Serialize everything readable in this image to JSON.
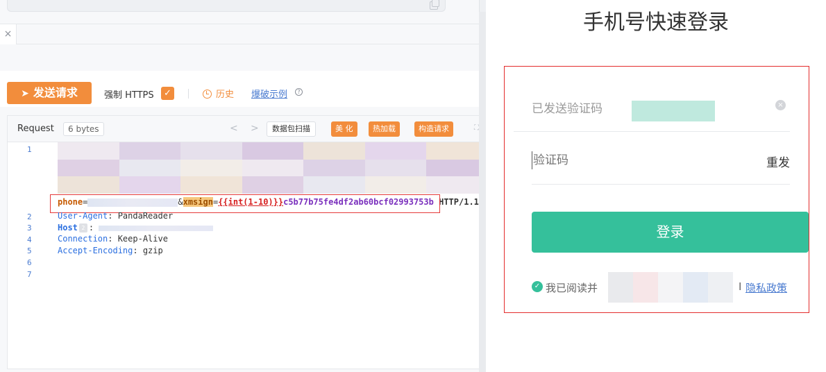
{
  "tab": {
    "close_glyph": "×"
  },
  "toolbar": {
    "send_label": "发送请求",
    "https_label": "强制 HTTPS",
    "history_label": "历史",
    "brute_example_label": "爆破示例",
    "https_checked": true
  },
  "editor": {
    "request_label": "Request",
    "bytes_label": "6 bytes",
    "buttons": {
      "packet_scan": "数据包扫描",
      "beautify": "美 化",
      "hot_load": "热加载",
      "build_request": "构造请求"
    },
    "line_numbers": [
      "1",
      "2",
      "3",
      "4",
      "5",
      "6",
      "7"
    ],
    "line1": {
      "phone_key": "phone",
      "eq1": "=",
      "amp": "&",
      "xmsign_key": "xmsign",
      "eq2": "=",
      "template": "{{int(1-10)}}",
      "hash": "c5b77b75fe4df2ab60bcf02993753b",
      "protocol": "HTTP/1.1"
    },
    "headers": [
      {
        "name": "User-Agent",
        "sep": ": ",
        "value": "PandaReader"
      },
      {
        "name": "Host",
        "badge": "2",
        "sep": ": ",
        "value": ""
      },
      {
        "name": "Connection",
        "sep": ": ",
        "value": "Keep-Alive"
      },
      {
        "name": "Accept-Encoding",
        "sep": ": ",
        "value": "gzip"
      }
    ]
  },
  "login": {
    "title": "手机号快速登录",
    "sent_code_text": "已发送验证码",
    "code_placeholder": "验证码",
    "resend_label": "重发",
    "login_button": "登录",
    "agree_text": "我已阅读并",
    "privacy_prefix": "I",
    "privacy_link": "隐私政策"
  },
  "colors": {
    "accent_orange": "#f28d3c",
    "accent_green": "#35c09b",
    "highlight_red": "#e53939",
    "link_blue": "#4a7bd0"
  }
}
